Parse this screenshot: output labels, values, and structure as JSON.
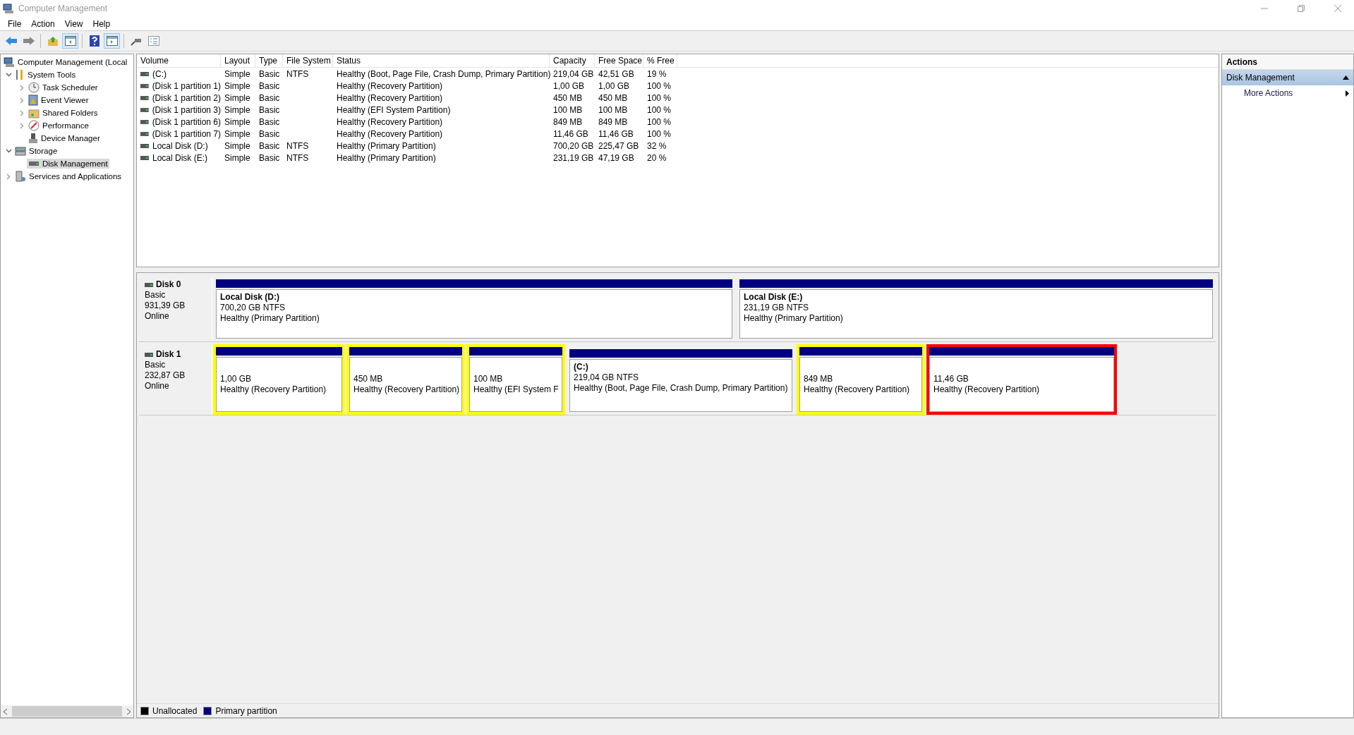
{
  "window": {
    "title": "Computer Management"
  },
  "menu": [
    "File",
    "Action",
    "View",
    "Help"
  ],
  "toolbar": [
    {
      "kind": "back",
      "pressed": false
    },
    {
      "kind": "forward",
      "pressed": false
    },
    {
      "kind": "sep"
    },
    {
      "kind": "up",
      "pressed": false
    },
    {
      "kind": "tree",
      "pressed": true
    },
    {
      "kind": "sep"
    },
    {
      "kind": "help",
      "pressed": false
    },
    {
      "kind": "pane",
      "pressed": true
    },
    {
      "kind": "sep"
    },
    {
      "kind": "connect",
      "pressed": false
    },
    {
      "kind": "props",
      "pressed": false
    }
  ],
  "tree": [
    {
      "label": "Computer Management (Local",
      "selected": false,
      "children": [
        {
          "label": "System Tools",
          "expanded": true,
          "selected": false,
          "children": [
            {
              "label": "Task Scheduler",
              "expanded": false,
              "selected": false
            },
            {
              "label": "Event Viewer",
              "expanded": false,
              "selected": false
            },
            {
              "label": "Shared Folders",
              "expanded": false,
              "selected": false
            },
            {
              "label": "Performance",
              "expanded": false,
              "selected": false
            },
            {
              "label": "Device Manager",
              "selected": false
            }
          ]
        },
        {
          "label": "Storage",
          "expanded": true,
          "selected": false,
          "children": [
            {
              "label": "Disk Management",
              "selected": true
            }
          ]
        },
        {
          "label": "Services and Applications",
          "expanded": false,
          "selected": false
        }
      ]
    }
  ],
  "table": {
    "columns": [
      "Volume",
      "Layout",
      "Type",
      "File System",
      "Status",
      "Capacity",
      "Free Space",
      "% Free"
    ],
    "rows": [
      [
        "(C:)",
        "Simple",
        "Basic",
        "NTFS",
        "Healthy (Boot, Page File, Crash Dump, Primary Partition)",
        "219,04 GB",
        "42,51 GB",
        "19 %"
      ],
      [
        "(Disk 1 partition 1)",
        "Simple",
        "Basic",
        "",
        "Healthy (Recovery Partition)",
        "1,00 GB",
        "1,00 GB",
        "100 %"
      ],
      [
        "(Disk 1 partition 2)",
        "Simple",
        "Basic",
        "",
        "Healthy (Recovery Partition)",
        "450 MB",
        "450 MB",
        "100 %"
      ],
      [
        "(Disk 1 partition 3)",
        "Simple",
        "Basic",
        "",
        "Healthy (EFI System Partition)",
        "100 MB",
        "100 MB",
        "100 %"
      ],
      [
        "(Disk 1 partition 6)",
        "Simple",
        "Basic",
        "",
        "Healthy (Recovery Partition)",
        "849 MB",
        "849 MB",
        "100 %"
      ],
      [
        "(Disk 1 partition 7)",
        "Simple",
        "Basic",
        "",
        "Healthy (Recovery Partition)",
        "11,46 GB",
        "11,46 GB",
        "100 %"
      ],
      [
        "Local Disk (D:)",
        "Simple",
        "Basic",
        "NTFS",
        "Healthy (Primary Partition)",
        "700,20 GB",
        "225,47 GB",
        "32 %"
      ],
      [
        "Local Disk (E:)",
        "Simple",
        "Basic",
        "NTFS",
        "Healthy (Primary Partition)",
        "231,19 GB",
        "47,19 GB",
        "20 %"
      ]
    ]
  },
  "disks": [
    {
      "name": "Disk 0",
      "type": "Basic",
      "size": "931,39 GB",
      "status": "Online",
      "partitions": [
        {
          "title": "Local Disk  (D:)",
          "size": "700,20 GB NTFS",
          "status": "Healthy (Primary Partition)"
        },
        {
          "title": "Local Disk  (E:)",
          "size": "231,19 GB NTFS",
          "status": "Healthy (Primary Partition)"
        }
      ]
    },
    {
      "name": "Disk 1",
      "type": "Basic",
      "size": "232,87 GB",
      "status": "Online",
      "partitions": [
        {
          "size": "1,00 GB",
          "status": "Healthy (Recovery Partition)",
          "color": "#ffff00"
        },
        {
          "size": "450 MB",
          "status": "Healthy (Recovery Partition)",
          "color": "#ffff00"
        },
        {
          "size": "100 MB",
          "status": "Healthy (EFI System F",
          "color": "#ffff00"
        },
        {
          "title": "(C:)",
          "size": "219,04 GB NTFS",
          "status": "Healthy (Boot, Page File, Crash Dump, Primary Partition)"
        },
        {
          "size": "849 MB",
          "status": "Healthy (Recovery Partition)",
          "color": "#ffff00"
        },
        {
          "size": "11,46 GB",
          "status": "Healthy (Recovery Partition)",
          "color": "#ff0000"
        }
      ]
    }
  ],
  "legend": [
    {
      "label": "Unallocated",
      "color": "#000000"
    },
    {
      "label": "Primary partition",
      "color": "#000080"
    }
  ],
  "actions": {
    "title": "Actions",
    "sections": [
      {
        "label": "Disk Management",
        "expanded": true,
        "items": [
          "More Actions"
        ]
      }
    ]
  }
}
